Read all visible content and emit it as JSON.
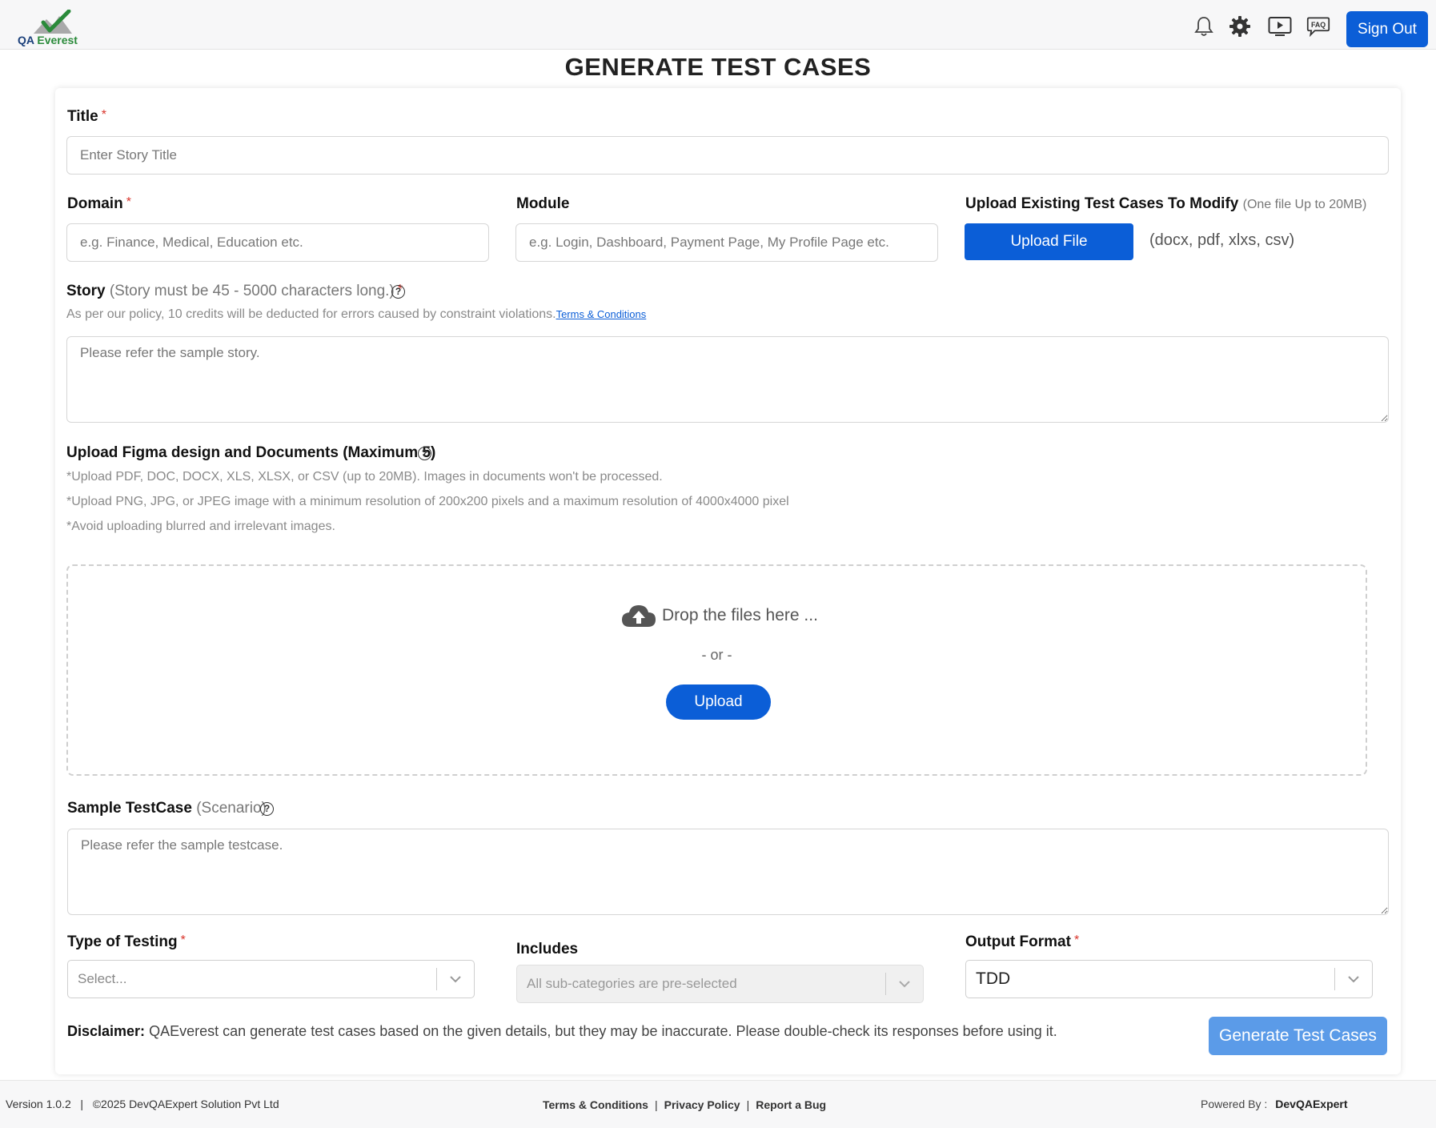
{
  "header": {
    "logo_text_a": "QA",
    "logo_text_b": "Everest",
    "signout_label": "Sign Out",
    "icons": [
      "bell-icon",
      "gear-icon",
      "video-play-icon",
      "faq-icon"
    ],
    "faq_glyph": "FAQ"
  },
  "page": {
    "title": "GENERATE TEST CASES"
  },
  "form": {
    "title_label": "Title",
    "title_placeholder": "Enter Story Title",
    "domain_label": "Domain",
    "domain_placeholder": "e.g. Finance, Medical, Education etc.",
    "module_label": "Module",
    "module_placeholder": "e.g. Login, Dashboard, Payment Page, My Profile Page etc.",
    "upload_existing_label": "Upload Existing Test Cases To Modify",
    "upload_existing_hint": "(One file Up to 20MB)",
    "upload_file_label": "Upload File",
    "upload_formats": "(docx, pdf, xlxs, csv)",
    "story_label": "Story",
    "story_hint": "(Story must be 45 - 5000 characters long.)",
    "story_policy": "As per our policy, 10 credits will be deducted for errors caused by constraint violations.",
    "terms_link": "Terms & Conditions",
    "story_placeholder": "Please refer the sample story.",
    "figma_label": "Upload Figma design and Documents (Maximum 5)",
    "figma_notes": [
      "*Upload PDF, DOC, DOCX, XLS, XLSX, or CSV (up to 20MB). Images in documents won't be processed.",
      "*Upload PNG, JPG, or JPEG image with a minimum resolution of 200x200 pixels and a maximum resolution of 4000x4000 pixel",
      "*Avoid uploading blurred and irrelevant images."
    ],
    "drop_text": "Drop the files here ...",
    "or_text": "- or -",
    "upload_label": "Upload",
    "sample_label": "Sample TestCase",
    "sample_hint": "(Scenario)",
    "sample_placeholder": "Please refer the sample testcase.",
    "testing_label": "Type of Testing",
    "testing_value": "Select...",
    "includes_label": "Includes",
    "includes_value": "All sub-categories are pre-selected",
    "output_label": "Output Format",
    "output_value": "TDD",
    "required_mark": "*",
    "help_glyph": "?",
    "disclaimer_label": "Disclaimer:",
    "disclaimer_text": "QAEverest can generate test cases based on the given details, but they may be inaccurate. Please double-check its responses before using it.",
    "generate_label": "Generate Test Cases"
  },
  "footer": {
    "version": "Version 1.0.2",
    "sep": "|",
    "copyright": "©2025 DevQAExpert Solution Pvt Ltd",
    "links": [
      "Terms & Conditions",
      "Privacy Policy",
      "Report a Bug"
    ],
    "powered_label": "Powered By :",
    "powered_by": "DevQAExpert"
  },
  "colors": {
    "primary": "#0b5ed7",
    "primary_light": "#5b9be8",
    "required": "#d9342b"
  }
}
